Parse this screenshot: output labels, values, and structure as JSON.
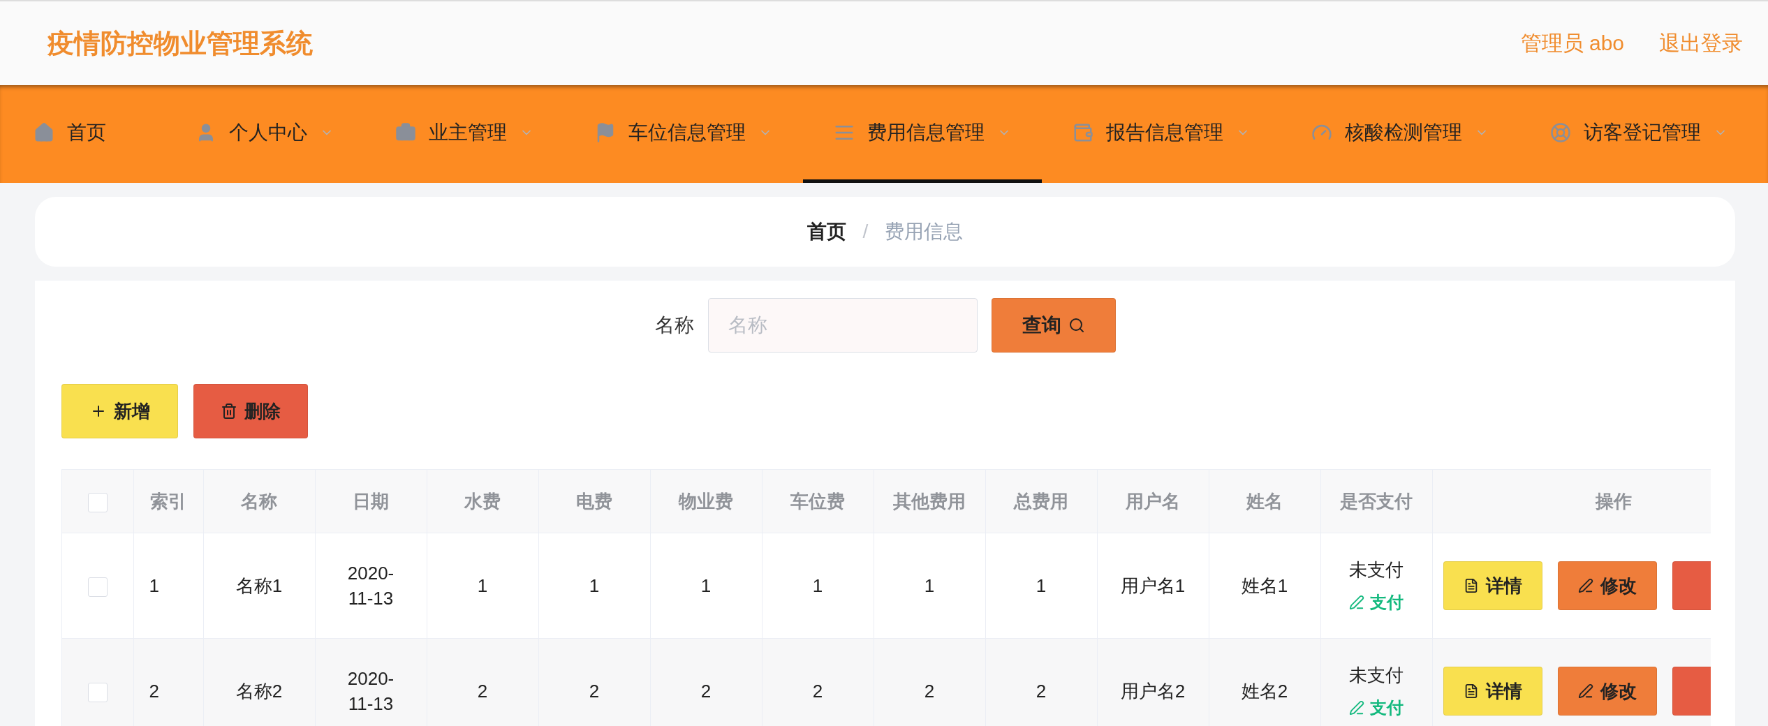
{
  "header": {
    "title": "疫情防控物业管理系统",
    "user_label": "管理员 abo",
    "logout": "退出登录"
  },
  "nav": [
    {
      "label": "首页",
      "selected": false,
      "dropdown": false
    },
    {
      "label": "个人中心",
      "selected": false,
      "dropdown": true
    },
    {
      "label": "业主管理",
      "selected": false,
      "dropdown": true
    },
    {
      "label": "车位信息管理",
      "selected": false,
      "dropdown": true
    },
    {
      "label": "费用信息管理",
      "selected": true,
      "dropdown": true
    },
    {
      "label": "报告信息管理",
      "selected": false,
      "dropdown": true
    },
    {
      "label": "核酸检测管理",
      "selected": false,
      "dropdown": true
    },
    {
      "label": "访客登记管理",
      "selected": false,
      "dropdown": true
    }
  ],
  "breadcrumb": [
    {
      "label": "首页",
      "current": false
    },
    {
      "label": "费用信息",
      "current": true
    }
  ],
  "breadcrumb_separator": "/",
  "search": {
    "label": "名称",
    "placeholder": "名称",
    "button": "查询"
  },
  "actions": [
    {
      "kind": "add",
      "label": "新增"
    },
    {
      "kind": "delete",
      "label": "删除"
    }
  ],
  "table": {
    "header_checked": false,
    "columns": [
      "索引",
      "名称",
      "日期",
      "水费",
      "电费",
      "物业费",
      "车位费",
      "其他费用",
      "总费用",
      "用户名",
      "姓名",
      "是否支付",
      "操作"
    ],
    "rows": [
      {
        "checked": false,
        "cells": [
          "1",
          "名称1",
          "2020-11-13",
          "1",
          "1",
          "1",
          "1",
          "1",
          "1",
          "用户名1",
          "姓名1"
        ],
        "payment_status": "未支付",
        "pay_link": "支付",
        "actions": [
          {
            "kind": "detail",
            "label": "详情"
          },
          {
            "kind": "edit",
            "label": "修改"
          },
          {
            "kind": "delete"
          }
        ]
      },
      {
        "checked": false,
        "cells": [
          "2",
          "名称2",
          "2020-11-13",
          "2",
          "2",
          "2",
          "2",
          "2",
          "2",
          "用户名2",
          "姓名2"
        ],
        "payment_status": "未支付",
        "pay_link": "支付",
        "actions": [
          {
            "kind": "detail",
            "label": "详情"
          },
          {
            "kind": "edit",
            "label": "修改"
          },
          {
            "kind": "delete"
          }
        ]
      }
    ]
  }
}
